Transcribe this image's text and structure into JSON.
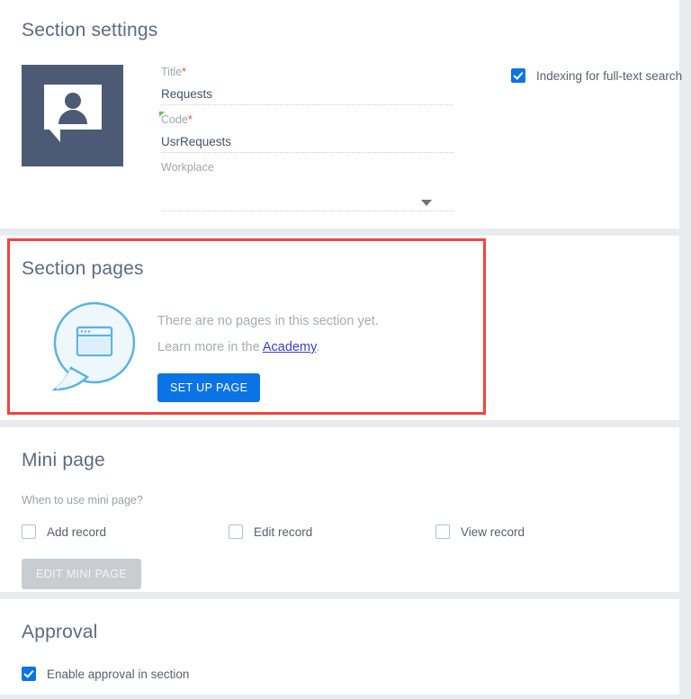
{
  "sections": {
    "section_settings": {
      "title": "Section settings",
      "icon_name": "person-speech-bubble-icon",
      "fields": [
        {
          "label": "Title",
          "required": true,
          "value": "Requests",
          "type": "text",
          "marker": false
        },
        {
          "label": "Code",
          "required": true,
          "value": "UsrRequests",
          "type": "text",
          "marker": true
        },
        {
          "label": "Workplace",
          "required": false,
          "value": "",
          "type": "dropdown",
          "marker": false
        }
      ],
      "options": [
        {
          "label": "Indexing for full-text search",
          "checked": true
        }
      ]
    },
    "section_pages": {
      "title": "Section pages",
      "highlighted": true,
      "highlight_color": "#f0463c",
      "icon_name": "browser-window-speech-bubble-icon",
      "empty_line_1": "There are no pages in this section yet.",
      "empty_line_2_prefix": "Learn more in the ",
      "empty_line_2_link": "Academy",
      "empty_line_2_suffix": ".",
      "button_label": "SET UP PAGE"
    },
    "mini_page": {
      "title": "Mini page",
      "question": "When to use mini page?",
      "options": [
        {
          "label": "Add record",
          "checked": false
        },
        {
          "label": "Edit record",
          "checked": false
        },
        {
          "label": "View record",
          "checked": false
        }
      ],
      "button_label": "EDIT MINI PAGE",
      "button_disabled": true
    },
    "approval": {
      "title": "Approval",
      "options": [
        {
          "label": "Enable approval in section",
          "checked": true
        }
      ]
    }
  },
  "colors": {
    "accent_blue": "#0a74e6",
    "highlight_red": "#f0463c",
    "icon_slate": "#4c5a75",
    "bubble_blue": "#5cb3e0",
    "link_blue": "#3c3cd0",
    "required_star": "#f0563b",
    "marker_green": "#6ac259",
    "page_background": "#e9ecee"
  }
}
